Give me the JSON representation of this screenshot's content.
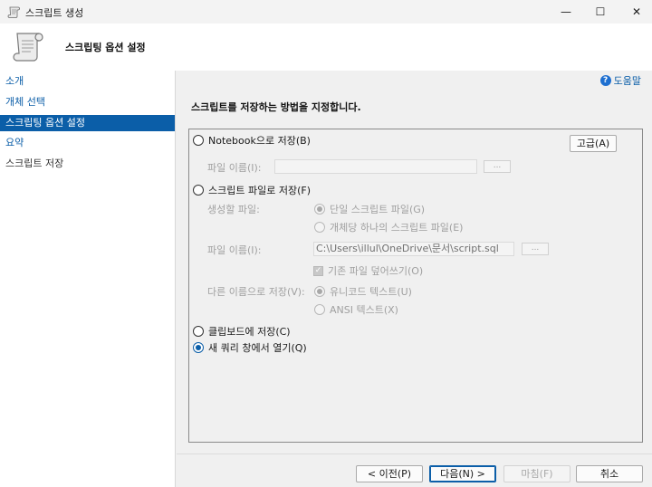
{
  "window": {
    "title": "스크립트 생성",
    "min_glyph": "—",
    "max_glyph": "☐",
    "close_glyph": "✕"
  },
  "header": {
    "title": "스크립팅 옵션 설정",
    "icon": "scroll-icon"
  },
  "sidebar": {
    "items": [
      {
        "label": "소개",
        "state": "link"
      },
      {
        "label": "개체 선택",
        "state": "link"
      },
      {
        "label": "스크립팅 옵션 설정",
        "state": "active"
      },
      {
        "label": "요약",
        "state": "link"
      },
      {
        "label": "스크립트 저장",
        "state": "plain"
      }
    ]
  },
  "help": {
    "label": "도움말",
    "icon_glyph": "?"
  },
  "instruction": "스크립트를 저장하는 방법을 지정합니다.",
  "options": {
    "notebook": {
      "label": "Notebook으로 저장(B)",
      "checked": false
    },
    "advanced_button": "고급(A)",
    "notebook_filename_label": "파일 이름(I):",
    "notebook_filename_value": "",
    "browse_label": "...",
    "script_file": {
      "label": "스크립트 파일로 저장(F)",
      "checked": false
    },
    "generate_files_label": "생성할 파일:",
    "single_file": {
      "label": "단일 스크립트 파일(G)",
      "checked": true
    },
    "per_object": {
      "label": "개체당 하나의 스크립트 파일(E)",
      "checked": false
    },
    "file_name_label": "파일 이름(I):",
    "file_name_value": "C:\\Users\\illul\\OneDrive\\문서\\script.sql",
    "overwrite": {
      "label": "기존 파일 덮어쓰기(O)",
      "checked": true
    },
    "save_as_label": "다른 이름으로 저장(V):",
    "unicode": {
      "label": "유니코드 텍스트(U)",
      "checked": true
    },
    "ansi": {
      "label": "ANSI 텍스트(X)",
      "checked": false
    },
    "clipboard": {
      "label": "클립보드에 저장(C)",
      "checked": false
    },
    "new_query": {
      "label": "새 쿼리 창에서 열기(Q)",
      "checked": true
    }
  },
  "buttons": {
    "previous": "< 이전(P)",
    "next": "다음(N) >",
    "finish": "마침(F)",
    "cancel": "취소"
  },
  "colors": {
    "accent": "#0b5ea8"
  }
}
